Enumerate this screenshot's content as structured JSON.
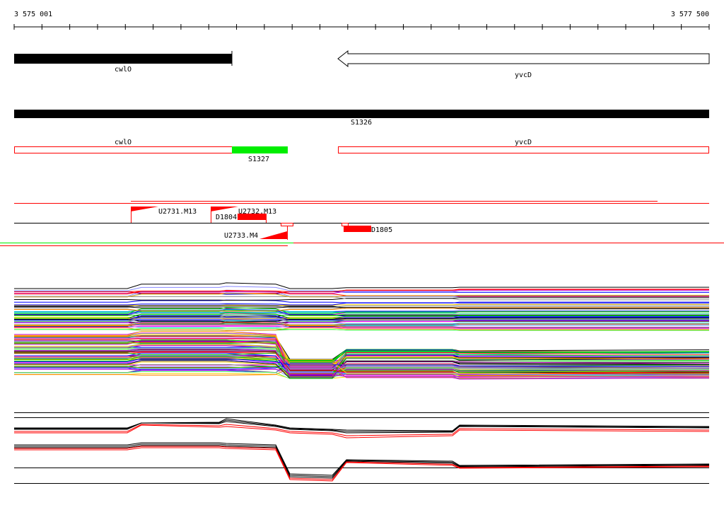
{
  "ruler": {
    "start_label": "3 575 001",
    "end_label": "3 577 500",
    "start": 3575001,
    "end": 3577500
  },
  "genes": {
    "cwlO": "cwlO",
    "yvcD": "yvcD"
  },
  "segments": {
    "s1326": "S1326",
    "s1327": "S1327",
    "cwlO": "cwlO",
    "yvcD": "yvcD"
  },
  "features": {
    "u2731": "U2731.M13",
    "u2732": "U2732.M13",
    "u2733": "U2733.M4",
    "d1804": "D1804",
    "d1805": "D1805"
  },
  "colors": {
    "red": "#ff0000",
    "green": "#00ee00",
    "black": "#000000",
    "palette": [
      "#ff0000",
      "#00cc00",
      "#0000ff",
      "#ff00ff",
      "#00cccc",
      "#ffcc00",
      "#000000",
      "#ff8800",
      "#8888ff",
      "#66ff66",
      "#cc00cc",
      "#888888"
    ]
  }
}
